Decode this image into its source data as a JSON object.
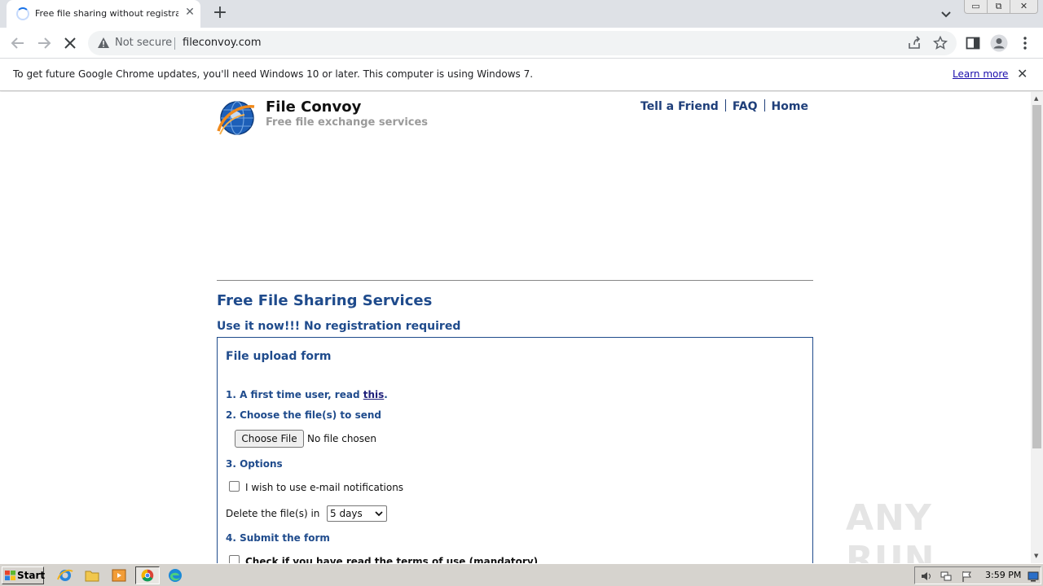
{
  "browser": {
    "tab_title": "Free file sharing without registration",
    "new_tab": "+",
    "tab_close": "✕",
    "security_label": "Not secure",
    "url": "fileconvoy.com",
    "window_controls": {
      "minimize": "▭",
      "maximize": "⧉",
      "close": "✕"
    }
  },
  "infobar": {
    "message": "To get future Google Chrome updates, you'll need Windows 10 or later. This computer is using Windows 7.",
    "learn_more": "Learn more",
    "close": "✕"
  },
  "site": {
    "title": "File Convoy",
    "subtitle": "Free file exchange services",
    "nav": [
      "Tell a Friend",
      "FAQ",
      "Home"
    ]
  },
  "main": {
    "heading": "Free File Sharing Services",
    "subheading": "Use it now!!! No registration required",
    "form": {
      "title": "File upload form",
      "step1_prefix": "1. A first time user, read ",
      "step1_link": "this",
      "step1_suffix": ".",
      "step2": "2. Choose the file(s) to send",
      "choose_button": "Choose File",
      "no_file": "No file chosen",
      "step3": "3. Options",
      "email_option": "I wish to use e-mail notifications",
      "delete_label": "Delete the file(s) in",
      "delete_value": "5 days",
      "step4": "4. Submit the form",
      "terms_label": "Check if you have read the terms of use (mandatory)"
    }
  },
  "watermark": "ANY RUN",
  "taskbar": {
    "start": "Start",
    "clock": "3:59 PM"
  }
}
